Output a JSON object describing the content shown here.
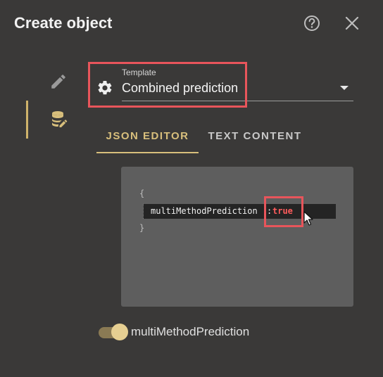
{
  "dialog": {
    "title": "Create object",
    "help_icon": "help-circle-icon",
    "close_icon": "close-icon"
  },
  "rail": {
    "items": [
      {
        "icon": "pencil-icon",
        "active": false
      },
      {
        "icon": "database-edit-icon",
        "active": true
      }
    ]
  },
  "template": {
    "label": "Template",
    "value": "Combined prediction",
    "icon": "gear-icon"
  },
  "tabs": [
    {
      "label": "JSON EDITOR",
      "active": true
    },
    {
      "label": "TEXT CONTENT",
      "active": false
    }
  ],
  "editor": {
    "open_brace": "{",
    "close_brace": "}",
    "key": "multiMethodPrediction",
    "colon": ":",
    "value": "true"
  },
  "toggle": {
    "label": "multiMethodPrediction",
    "checked": true
  },
  "colors": {
    "background": "#3a3938",
    "accent": "#d8bf7c",
    "highlight": "#e8555b",
    "editor_bg": "#5e5e5e",
    "value_red": "#ff5c5c"
  }
}
